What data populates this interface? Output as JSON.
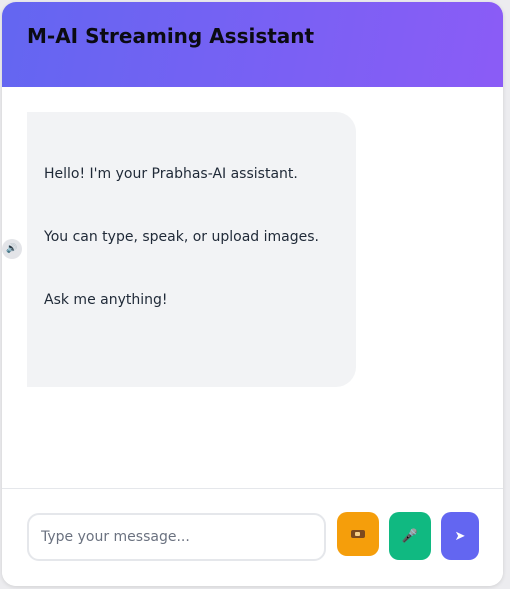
{
  "header": {
    "title": "M-AI Streaming Assistant"
  },
  "messages": [
    {
      "role": "assistant",
      "lines": [
        "Hello! I'm your Prabhas-AI assistant.",
        "You can type, speak, or upload images.",
        "Ask me anything!"
      ]
    }
  ],
  "input": {
    "placeholder": "Type your message..."
  },
  "buttons": {
    "upload_icon": "image-upload-icon",
    "mic_icon": "microphone-icon",
    "mic_glyph": "🎤",
    "send_icon": "send-icon",
    "send_glyph": "➤",
    "speaker_icon": "speaker-icon",
    "speaker_glyph": "🔊"
  },
  "colors": {
    "header_start": "#6366f1",
    "header_end": "#8b5cf6",
    "upload": "#f59e0b",
    "mic": "#10b981",
    "send": "#6366f1",
    "bubble": "#f2f3f5"
  }
}
